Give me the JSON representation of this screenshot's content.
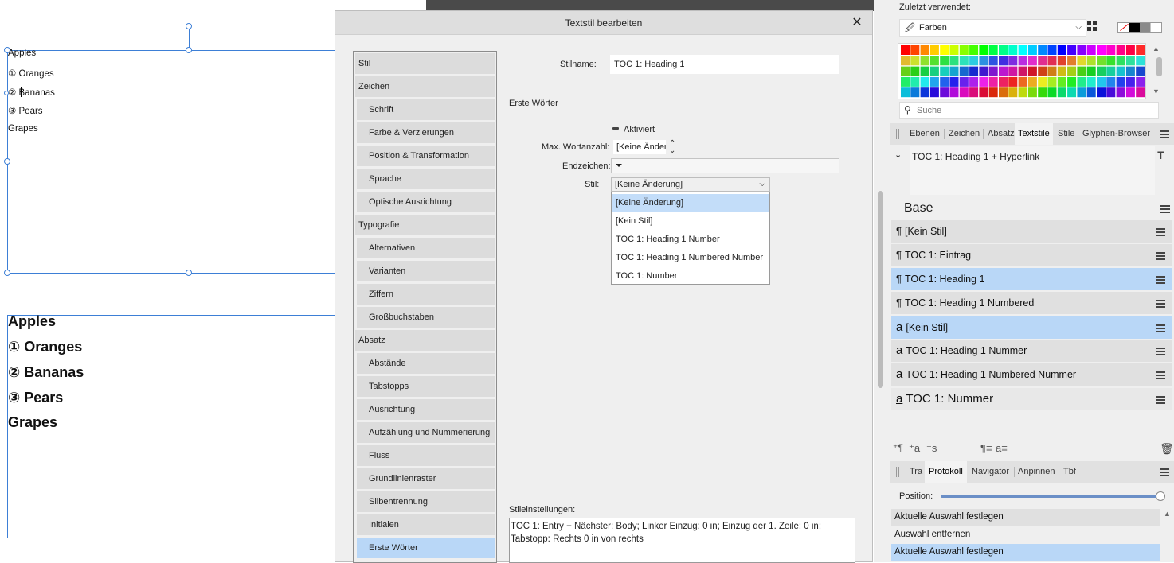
{
  "canvas": {
    "list_small": [
      "Apples",
      "① Oranges",
      "② Bananas",
      "③ Pears",
      "Grapes"
    ],
    "list_large": [
      "Apples",
      "① Oranges",
      "② Bananas",
      "③ Pears",
      "Grapes"
    ]
  },
  "dialog": {
    "title": "Textstil bearbeiten",
    "close_glyph": "✕",
    "categories": [
      {
        "label": "Stil",
        "sub": false,
        "selected": false
      },
      {
        "label": "Zeichen",
        "sub": false,
        "selected": false
      },
      {
        "label": "Schrift",
        "sub": true,
        "selected": false
      },
      {
        "label": "Farbe & Verzierungen",
        "sub": true,
        "selected": false
      },
      {
        "label": "Position & Transformation",
        "sub": true,
        "selected": false
      },
      {
        "label": "Sprache",
        "sub": true,
        "selected": false
      },
      {
        "label": "Optische Ausrichtung",
        "sub": true,
        "selected": false
      },
      {
        "label": "Typografie",
        "sub": false,
        "selected": false
      },
      {
        "label": "Alternativen",
        "sub": true,
        "selected": false
      },
      {
        "label": "Varianten",
        "sub": true,
        "selected": false
      },
      {
        "label": "Ziffern",
        "sub": true,
        "selected": false
      },
      {
        "label": "Großbuchstaben",
        "sub": true,
        "selected": false
      },
      {
        "label": "Absatz",
        "sub": false,
        "selected": false
      },
      {
        "label": "Abstände",
        "sub": true,
        "selected": false
      },
      {
        "label": "Tabstopps",
        "sub": true,
        "selected": false
      },
      {
        "label": "Ausrichtung",
        "sub": true,
        "selected": false
      },
      {
        "label": "Aufzählung und Nummerierung",
        "sub": true,
        "selected": false
      },
      {
        "label": "Fluss",
        "sub": true,
        "selected": false
      },
      {
        "label": "Grundlinienraster",
        "sub": true,
        "selected": false
      },
      {
        "label": "Silbentrennung",
        "sub": true,
        "selected": false
      },
      {
        "label": "Initialen",
        "sub": true,
        "selected": false
      },
      {
        "label": "Erste Wörter",
        "sub": true,
        "selected": true
      }
    ],
    "stilname_label": "Stilname:",
    "stilname_value": "TOC 1: Heading 1",
    "section_title": "Erste Wörter",
    "aktiviert_label": "Aktiviert",
    "max_words_label": "Max. Wortanzahl:",
    "max_words_value": "[Keine Änder",
    "endzeichen_label": "Endzeichen:",
    "stil_label": "Stil:",
    "stil_value": "[Keine Änderung]",
    "dropdown_options": [
      {
        "label": "[Keine Änderung]",
        "selected": true
      },
      {
        "label": "[Kein Stil]",
        "selected": false
      },
      {
        "label": "TOC 1: Heading 1 Number",
        "selected": false
      },
      {
        "label": "TOC 1: Heading 1 Numbered Number",
        "selected": false
      },
      {
        "label": "TOC 1: Number",
        "selected": false
      }
    ],
    "settings_label": "Stileinstellungen:",
    "settings_text": "TOC 1: Entry + Nächster: Body; Linker Einzug: 0 in; Einzug der 1. Zeile: 0 in; Tabstopp: Rechts 0 in von rechts"
  },
  "right_panel": {
    "recent_label": "Zuletzt verwendet:",
    "color_mode": "Farben",
    "search_placeholder": "Suche",
    "palette": [
      "#ff0000",
      "#ff4400",
      "#ff8800",
      "#ffcc00",
      "#ffff00",
      "#ccff00",
      "#88ff00",
      "#44ff00",
      "#00ff00",
      "#00ff44",
      "#00ff88",
      "#00ffcc",
      "#00ffff",
      "#00ccff",
      "#0088ff",
      "#0044ff",
      "#0000ff",
      "#4400ff",
      "#8800ff",
      "#cc00ff",
      "#ff00ff",
      "#ff00cc",
      "#ff0088",
      "#ff0044",
      "#ff2a2a",
      "#ff6a00"
    ],
    "panel_tabs": [
      "Ebenen",
      "Zeichen",
      "Absatz",
      "Textstile",
      "Stile",
      "Glyphen-Browser"
    ],
    "active_panel_tab": "Textstile",
    "current_style": "TOC 1: Heading 1 + Hyperlink",
    "base_label": "Base",
    "styles": [
      {
        "icon": "¶",
        "label": "[Kein Stil]",
        "selected": false
      },
      {
        "icon": "¶",
        "label": "TOC 1: Eintrag",
        "selected": false
      },
      {
        "icon": "¶",
        "label": "TOC 1: Heading 1",
        "selected": true
      },
      {
        "icon": "¶",
        "label": "TOC 1: Heading 1 Numbered",
        "selected": false
      },
      {
        "icon": "a",
        "label": "[Kein Stil]",
        "selected": true
      },
      {
        "icon": "a",
        "label": "TOC 1: Heading 1 Nummer",
        "selected": false
      },
      {
        "icon": "a",
        "label": "TOC 1: Heading 1 Numbered Nummer",
        "selected": false
      },
      {
        "icon": "a",
        "label": "TOC 1: Nummer",
        "selected": false
      }
    ],
    "bottom_tabs": [
      "Tra",
      "Protokoll",
      "Navigator",
      "Anpinnen",
      "Tbf"
    ],
    "active_bottom_tab": "Protokoll",
    "position_label": "Position:",
    "position_value": 1.0,
    "history": [
      {
        "label": "Aktuelle Auswahl festlegen",
        "selected": false
      },
      {
        "label": "Auswahl entfernen",
        "selected": false
      },
      {
        "label": "Aktuelle Auswahl festlegen",
        "selected": true
      }
    ]
  }
}
